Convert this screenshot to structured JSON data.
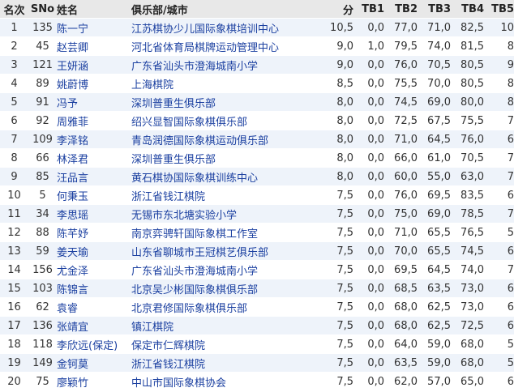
{
  "headers": {
    "rank": "名次",
    "sno": "SNo",
    "name": "姓名",
    "club": "俱乐部/城市",
    "pts": "分",
    "tb1": "TB1",
    "tb2": "TB2",
    "tb3": "TB3",
    "tb4": "TB4",
    "tb5": "TB5"
  },
  "rows": [
    {
      "rank": "1",
      "sno": "135",
      "name": "陈一宁",
      "club": "江苏棋协少儿国际象棋培训中心",
      "pts": "10,5",
      "tb1": "0,0",
      "tb2": "77,0",
      "tb3": "71,0",
      "tb4": "82,5",
      "tb5": "10"
    },
    {
      "rank": "2",
      "sno": "45",
      "name": "赵芸卿",
      "club": "河北省体育局棋牌运动管理中心",
      "pts": "9,0",
      "tb1": "1,0",
      "tb2": "79,5",
      "tb3": "74,0",
      "tb4": "81,5",
      "tb5": "8"
    },
    {
      "rank": "3",
      "sno": "121",
      "name": "王妍涵",
      "club": "广东省汕头市澄海城南小学",
      "pts": "9,0",
      "tb1": "0,0",
      "tb2": "76,0",
      "tb3": "70,5",
      "tb4": "80,5",
      "tb5": "9"
    },
    {
      "rank": "4",
      "sno": "89",
      "name": "姚蔚博",
      "club": "上海棋院",
      "pts": "8,5",
      "tb1": "0,0",
      "tb2": "75,5",
      "tb3": "70,0",
      "tb4": "80,5",
      "tb5": "8"
    },
    {
      "rank": "5",
      "sno": "91",
      "name": "冯予",
      "club": "深圳普重生俱乐部",
      "pts": "8,0",
      "tb1": "0,0",
      "tb2": "74,5",
      "tb3": "69,0",
      "tb4": "80,0",
      "tb5": "8"
    },
    {
      "rank": "6",
      "sno": "92",
      "name": "周雅菲",
      "club": "绍兴显智国际象棋俱乐部",
      "pts": "8,0",
      "tb1": "0,0",
      "tb2": "72,5",
      "tb3": "67,5",
      "tb4": "75,5",
      "tb5": "7"
    },
    {
      "rank": "7",
      "sno": "109",
      "name": "李泽铭",
      "club": "青岛润德国际象棋运动俱乐部",
      "pts": "8,0",
      "tb1": "0,0",
      "tb2": "71,0",
      "tb3": "64,5",
      "tb4": "76,0",
      "tb5": "6"
    },
    {
      "rank": "8",
      "sno": "66",
      "name": "林泽君",
      "club": "深圳普重生俱乐部",
      "pts": "8,0",
      "tb1": "0,0",
      "tb2": "66,0",
      "tb3": "61,0",
      "tb4": "70,5",
      "tb5": "7"
    },
    {
      "rank": "9",
      "sno": "85",
      "name": "汪品言",
      "club": "黄石棋协国际象棋训练中心",
      "pts": "8,0",
      "tb1": "0,0",
      "tb2": "60,0",
      "tb3": "55,0",
      "tb4": "63,0",
      "tb5": "7"
    },
    {
      "rank": "10",
      "sno": "5",
      "name": "何秉玉",
      "club": "浙江省钱江棋院",
      "pts": "7,5",
      "tb1": "0,0",
      "tb2": "76,0",
      "tb3": "69,5",
      "tb4": "83,5",
      "tb5": "6"
    },
    {
      "rank": "11",
      "sno": "34",
      "name": "李思瑶",
      "club": "无锡市东北塘实验小学",
      "pts": "7,5",
      "tb1": "0,0",
      "tb2": "75,0",
      "tb3": "69,0",
      "tb4": "78,5",
      "tb5": "7"
    },
    {
      "rank": "12",
      "sno": "88",
      "name": "陈芊妤",
      "club": "南京弈骋轩国际象棋工作室",
      "pts": "7,5",
      "tb1": "0,0",
      "tb2": "71,0",
      "tb3": "65,5",
      "tb4": "76,5",
      "tb5": "5"
    },
    {
      "rank": "13",
      "sno": "59",
      "name": "姜天瑜",
      "club": "山东省聊城市王冠棋艺俱乐部",
      "pts": "7,5",
      "tb1": "0,0",
      "tb2": "70,0",
      "tb3": "65,5",
      "tb4": "74,5",
      "tb5": "6"
    },
    {
      "rank": "14",
      "sno": "156",
      "name": "尤金泽",
      "club": "广东省汕头市澄海城南小学",
      "pts": "7,5",
      "tb1": "0,0",
      "tb2": "69,5",
      "tb3": "64,5",
      "tb4": "74,0",
      "tb5": "7"
    },
    {
      "rank": "15",
      "sno": "103",
      "name": "陈锦言",
      "club": "北京吴少彬国际象棋俱乐部",
      "pts": "7,5",
      "tb1": "0,0",
      "tb2": "68,5",
      "tb3": "63,5",
      "tb4": "73,0",
      "tb5": "6"
    },
    {
      "rank": "16",
      "sno": "62",
      "name": "袁睿",
      "club": "北京君修国际象棋俱乐部",
      "pts": "7,5",
      "tb1": "0,0",
      "tb2": "68,0",
      "tb3": "62,5",
      "tb4": "73,0",
      "tb5": "6"
    },
    {
      "rank": "17",
      "sno": "136",
      "name": "张靖宜",
      "club": "镇江棋院",
      "pts": "7,5",
      "tb1": "0,0",
      "tb2": "68,0",
      "tb3": "62,5",
      "tb4": "72,5",
      "tb5": "6"
    },
    {
      "rank": "18",
      "sno": "118",
      "name": "李欣远(保定)",
      "club": "保定市仁辉棋院",
      "pts": "7,5",
      "tb1": "0,0",
      "tb2": "64,0",
      "tb3": "59,0",
      "tb4": "68,0",
      "tb5": "5"
    },
    {
      "rank": "19",
      "sno": "149",
      "name": "金钶莫",
      "club": "浙江省钱江棋院",
      "pts": "7,5",
      "tb1": "0,0",
      "tb2": "63,5",
      "tb3": "59,0",
      "tb4": "68,0",
      "tb5": "5"
    },
    {
      "rank": "20",
      "sno": "75",
      "name": "廖颖竹",
      "club": "中山市国际象棋协会",
      "pts": "7,5",
      "tb1": "0,0",
      "tb2": "62,0",
      "tb3": "57,0",
      "tb4": "65,0",
      "tb5": "6"
    }
  ]
}
